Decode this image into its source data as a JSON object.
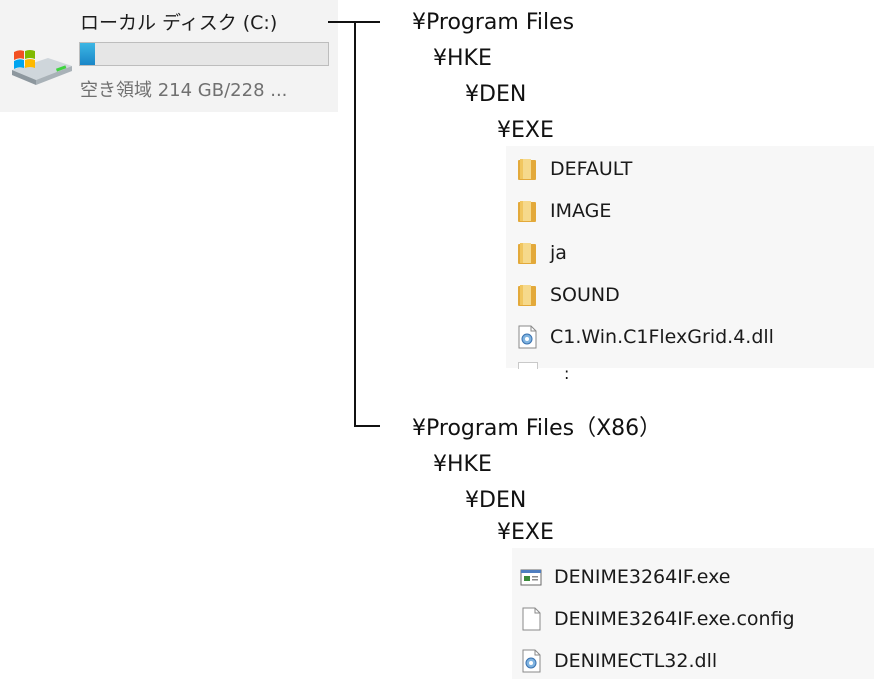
{
  "drive": {
    "name": "ローカル ディスク (C:)",
    "free_space": "空き領域 214 GB/228 ...",
    "used_fraction": 0.06,
    "icon": "windows-drive-icon"
  },
  "tree1": {
    "root": "¥Program Files",
    "level1": "¥HKE",
    "level2": "¥DEN",
    "level3": "¥EXE",
    "items": [
      {
        "label": "DEFAULT",
        "icon": "folder-icon"
      },
      {
        "label": "IMAGE",
        "icon": "folder-icon"
      },
      {
        "label": "ja",
        "icon": "folder-icon"
      },
      {
        "label": "SOUND",
        "icon": "folder-icon"
      },
      {
        "label": "C1.Win.C1FlexGrid.4.dll",
        "icon": "dll-file-icon"
      }
    ],
    "more_mark": ":"
  },
  "tree2": {
    "root": "¥Program Files（X86）",
    "level1": "¥HKE",
    "level2": "¥DEN",
    "level3": "¥EXE",
    "items": [
      {
        "label": "DENIME3264IF.exe",
        "icon": "exe-file-icon"
      },
      {
        "label": "DENIME3264IF.exe.config",
        "icon": "config-file-icon"
      },
      {
        "label": "DENIMECTL32.dll",
        "icon": "dll-file-icon"
      }
    ]
  },
  "colors": {
    "drive_bar_fill": "#1a86c7",
    "folder": "#e8b84a",
    "listing_bg": "#f7f7f7"
  }
}
